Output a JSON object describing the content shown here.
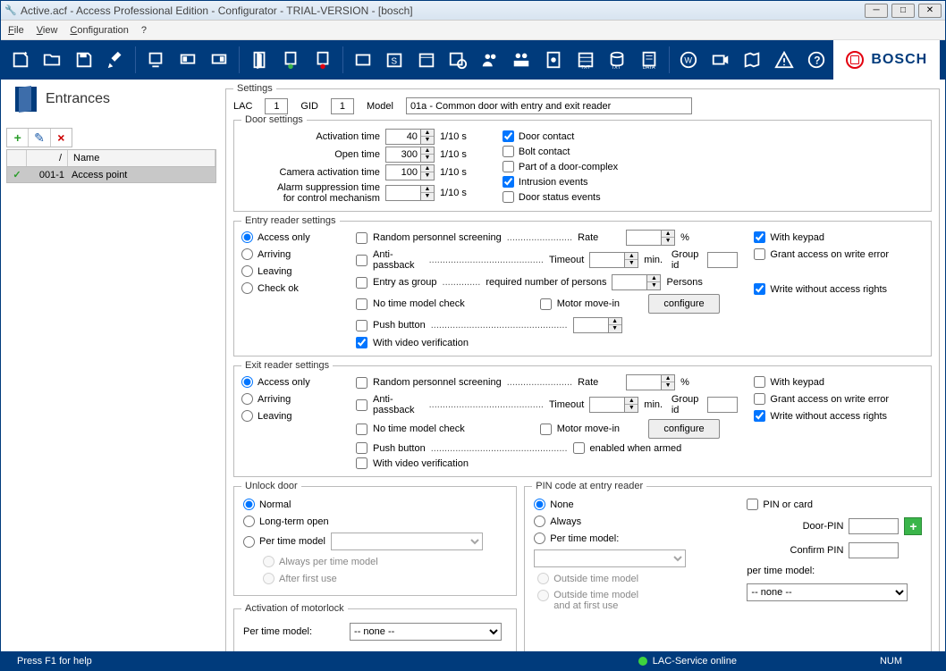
{
  "window": {
    "title": "Active.acf - Access Professional Edition - Configurator - TRIAL-VERSION - [bosch]"
  },
  "menu": {
    "file": "File",
    "view": "View",
    "config": "Configuration",
    "help": "?"
  },
  "brand": "BOSCH",
  "page": {
    "title": "Entrances"
  },
  "tree": {
    "cols": {
      "c2": "/",
      "c3": "Name"
    },
    "row": {
      "id": "001-1",
      "name": "Access point"
    }
  },
  "settings": {
    "legend": "Settings",
    "lac_label": "LAC",
    "lac": "1",
    "gid_label": "GID",
    "gid": "1",
    "model_label": "Model",
    "model": "01a - Common door with entry and exit reader"
  },
  "door": {
    "legend": "Door settings",
    "activation_label": "Activation time",
    "activation": "40",
    "open_label": "Open time",
    "open": "300",
    "cam_label": "Camera activation time",
    "cam": "100",
    "alarm_label1": "Alarm suppression time",
    "alarm_label2": "for control mechanism",
    "alarm": "",
    "unit": "1/10 s",
    "door_contact": "Door contact",
    "bolt_contact": "Bolt contact",
    "part_complex": "Part of a door-complex",
    "intrusion": "Intrusion events",
    "status_events": "Door status events"
  },
  "entry": {
    "legend": "Entry reader settings",
    "access_only": "Access only",
    "arriving": "Arriving",
    "leaving": "Leaving",
    "checkok": "Check ok",
    "rand": "Random personnel screening",
    "rand_dots": "........................",
    "rate": "Rate",
    "pct": "%",
    "anti": "Anti-passback",
    "anti_dots": "..........................................",
    "timeout": "Timeout",
    "min": "min.",
    "group": "Entry as group",
    "group_dots": "..............",
    "group_req": "required number of persons",
    "persons": "Persons",
    "groupid": "Group id",
    "notime": "No time model check",
    "motor": "Motor move-in",
    "configure": "configure",
    "push": "Push button",
    "push_dots": "..................................................",
    "video": "With video verification",
    "keypad": "With keypad",
    "grant_err": "Grant access on write error",
    "write_no": "Write without access rights"
  },
  "exit": {
    "legend": "Exit reader settings",
    "access_only": "Access only",
    "arriving": "Arriving",
    "leaving": "Leaving",
    "rand": "Random personnel screening",
    "rand_dots": "........................",
    "rate": "Rate",
    "pct": "%",
    "anti": "Anti-passback",
    "anti_dots": "..........................................",
    "timeout": "Timeout",
    "min": "min.",
    "notime": "No time model check",
    "motor": "Motor move-in",
    "configure": "configure",
    "push": "Push button",
    "push_dots": "..................................................",
    "armed": "enabled when armed",
    "video": "With video verification",
    "keypad": "With keypad",
    "grant_err": "Grant access on write error",
    "write_no": "Write without access rights",
    "groupid": "Group id"
  },
  "unlock": {
    "legend": "Unlock door",
    "normal": "Normal",
    "long": "Long-term open",
    "ptm": "Per time model",
    "always_ptm": "Always per time model",
    "after_first": "After first use"
  },
  "motorlock": {
    "legend": "Activation of motorlock",
    "ptm": "Per time model:",
    "none": "-- none --"
  },
  "pin": {
    "legend": "PIN code at entry reader",
    "none": "None",
    "always": "Always",
    "ptm": "Per time model:",
    "out1": "Outside time model",
    "out2a": "Outside time model",
    "out2b": "and at first use",
    "pin_or_card": "PIN or card",
    "doorpin": "Door-PIN",
    "confirm": "Confirm PIN",
    "ptm_label": "per time model:",
    "none_opt": "-- none --"
  },
  "status": {
    "help": "Press F1 for help",
    "lac": "LAC-Service online",
    "num": "NUM"
  }
}
